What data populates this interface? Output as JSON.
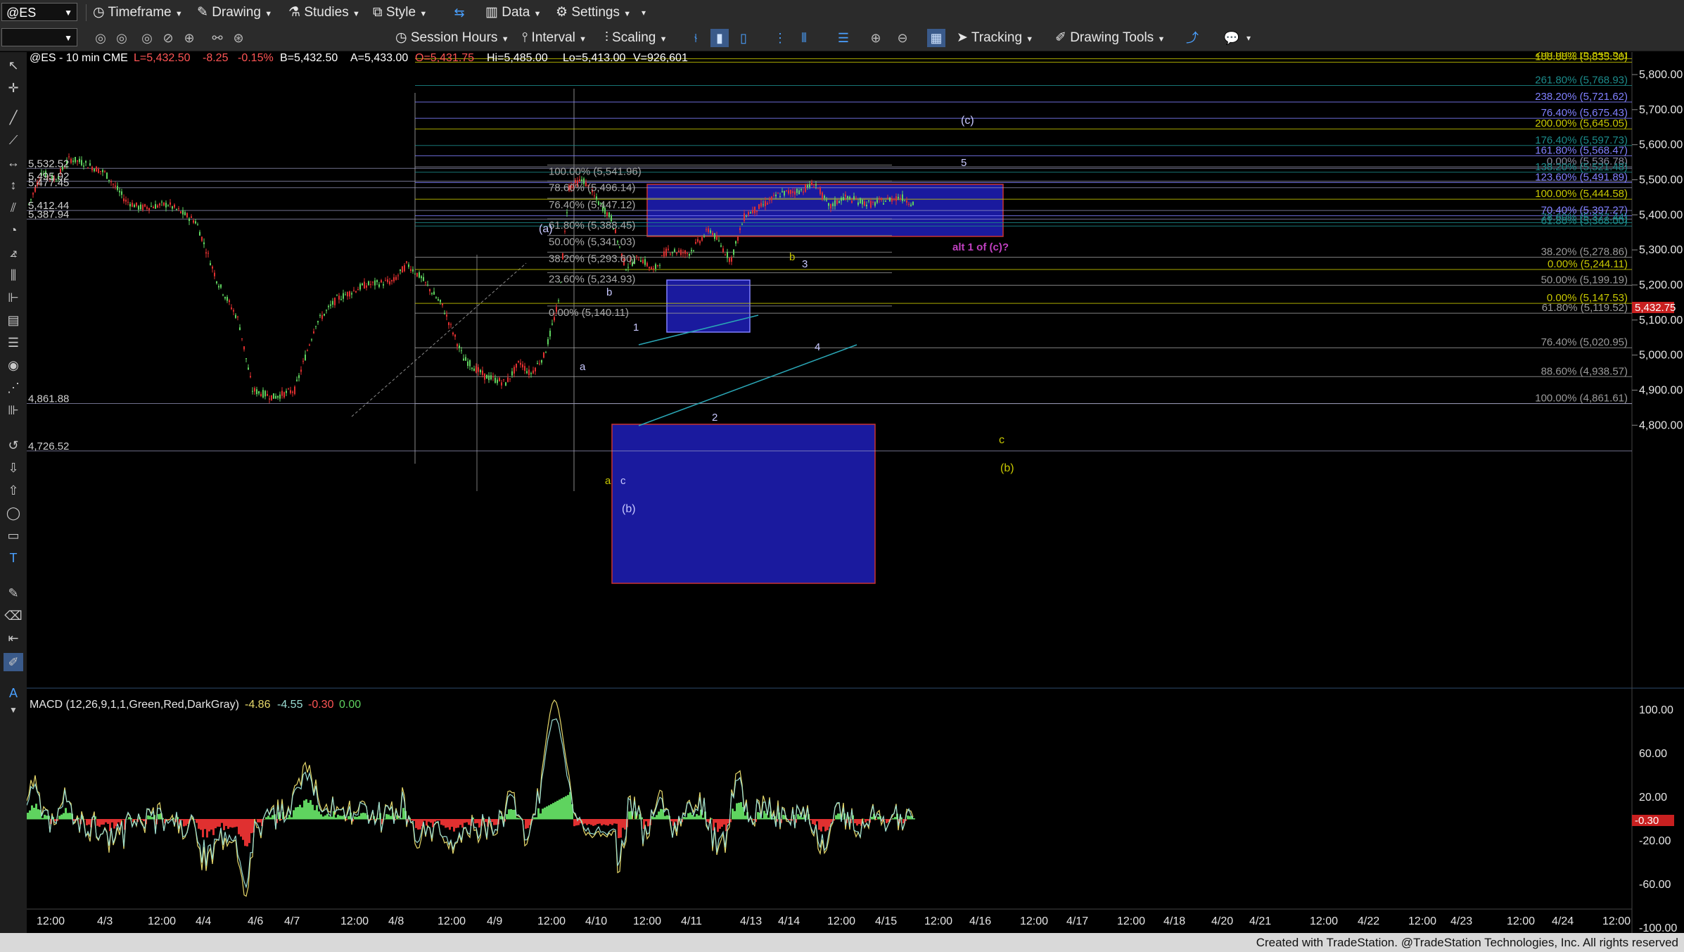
{
  "toolbar1": {
    "symbol": "@ES",
    "timeframe": "Timeframe",
    "drawing": "Drawing",
    "studies": "Studies",
    "style": "Style",
    "data": "Data",
    "settings": "Settings"
  },
  "toolbar2": {
    "session_hours": "Session Hours",
    "interval": "Interval",
    "scaling": "Scaling",
    "tracking": "Tracking",
    "drawing_tools": "Drawing Tools"
  },
  "header": {
    "title": "@ES - 10 min  CME",
    "last": "L=5,432.50",
    "change": "-8.25",
    "change_pct": "-0.15%",
    "bid": "B=5,432.50",
    "ask": "A=5,433.00",
    "open": "O=5,431.75",
    "high": "Hi=5,485.00",
    "low": "Lo=5,413.00",
    "volume": "V=926,601"
  },
  "colors": {
    "up": "#5fd35f",
    "down": "#e03030",
    "accent_blue": "#1a1a9e",
    "fib_cyan": "#1c8a8a",
    "fib_yellow": "#c8c800",
    "fib_violet": "#8080ff",
    "label_magenta": "#c040c0"
  },
  "price_axis": {
    "labels": [
      "5,800.00",
      "5,700.00",
      "5,600.00",
      "5,500.00",
      "5,400.00",
      "5,300.00",
      "5,200.00",
      "5,100.00",
      "5,000.00",
      "4,900.00",
      "4,800.00"
    ],
    "current": "5,432.75"
  },
  "left_levels": [
    "5,532.52",
    "5,495.92",
    "5,477.45",
    "5,412.44",
    "5,387.94",
    "4,861.88",
    "4,726.52"
  ],
  "fib_right": [
    {
      "text": "200.00% (5,845.51)",
      "color": "#c8c800"
    },
    {
      "text": "100.00% (5,835.30)",
      "color": "#c8c800"
    },
    {
      "text": "261.80% (5,768.93)",
      "color": "#1c8a8a"
    },
    {
      "text": "238.20% (5,721.62)",
      "color": "#8080ff"
    },
    {
      "text": "76.40% (5,675.43)",
      "color": "#8080ff"
    },
    {
      "text": "200.00% (5,645.05)",
      "color": "#c8c800"
    },
    {
      "text": "176.40% (5,597.73)",
      "color": "#1c8a8a"
    },
    {
      "text": "161.80% (5,568.47)",
      "color": "#8080ff"
    },
    {
      "text": "0.00% (5,536.78)",
      "color": "#8a8aa0"
    },
    {
      "text": "138.20% (5,521.48)",
      "color": "#1c8a8a"
    },
    {
      "text": "123.60% (5,491.89)",
      "color": "#8080ff"
    },
    {
      "text": "100.00% (5,444.58)",
      "color": "#c8c800"
    },
    {
      "text": "70.40% (5,397.27)",
      "color": "#8080ff"
    },
    {
      "text": "78.60% (5,377.44)",
      "color": "#1c8a8a"
    },
    {
      "text": "61.80% (5,368.00)",
      "color": "#1c8a8a"
    },
    {
      "text": "38.20% (5,278.86)",
      "color": "#9a9a9a"
    },
    {
      "text": "0.00% (5,244.11)",
      "color": "#c8c800"
    },
    {
      "text": "50.00% (5,199.19)",
      "color": "#9a9a9a"
    },
    {
      "text": "0.00% (5,147.53)",
      "color": "#c8c800"
    },
    {
      "text": "61.80% (5,119.52)",
      "color": "#9a9a9a"
    },
    {
      "text": "76.40% (5,020.95)",
      "color": "#9a9a9a"
    },
    {
      "text": "88.60% (4,938.57)",
      "color": "#9a9a9a"
    },
    {
      "text": "100.00% (4,861.61)",
      "color": "#9a9a9a"
    }
  ],
  "fib_mid": [
    "100.00% (5,541.96)",
    "78.60% (5,496.14)",
    "76.40% (5,447.12)",
    "61.80% (5,388.45)",
    "50.00% (5,341.03)",
    "38.20% (5,293.60)",
    "23.60% (5,234.93)",
    "0.00% (5,140.11)"
  ],
  "wave_labels": {
    "a_paren": "(a)",
    "b_paren": "(b)",
    "c_paren": "(c)",
    "b_yellow_paren": "(b)",
    "c_yellow": "c",
    "one": "1",
    "two": "2",
    "three": "3",
    "four": "4",
    "five": "5",
    "a1": "a",
    "b1": "b",
    "c1": "c",
    "a_y": "a",
    "b_y": "b",
    "alt": "alt 1 of (c)?"
  },
  "macd": {
    "label": "MACD (12,26,9,1,1,Green,Red,DarkGray)",
    "v1": "-4.86",
    "v2": "-4.55",
    "v3": "-0.30",
    "v4": "0.00",
    "axis": [
      "100.00",
      "60.00",
      "20.00",
      "-20.00",
      "-60.00",
      "-100.00"
    ],
    "current": "-0.30"
  },
  "time_axis": [
    "12:00",
    "4/3",
    "12:00",
    "4/4",
    "4/6",
    "4/7",
    "12:00",
    "4/8",
    "12:00",
    "4/9",
    "12:00",
    "4/10",
    "12:00",
    "4/11",
    "4/13",
    "4/14",
    "12:00",
    "4/15",
    "12:00",
    "4/16",
    "12:00",
    "4/17",
    "12:00",
    "4/18",
    "4/20",
    "4/21",
    "12:00",
    "4/22",
    "12:00",
    "4/23",
    "12:00",
    "4/24",
    "12:00"
  ],
  "footer": "Created with TradeStation. @TradeStation Technologies, Inc. All rights reserved"
}
